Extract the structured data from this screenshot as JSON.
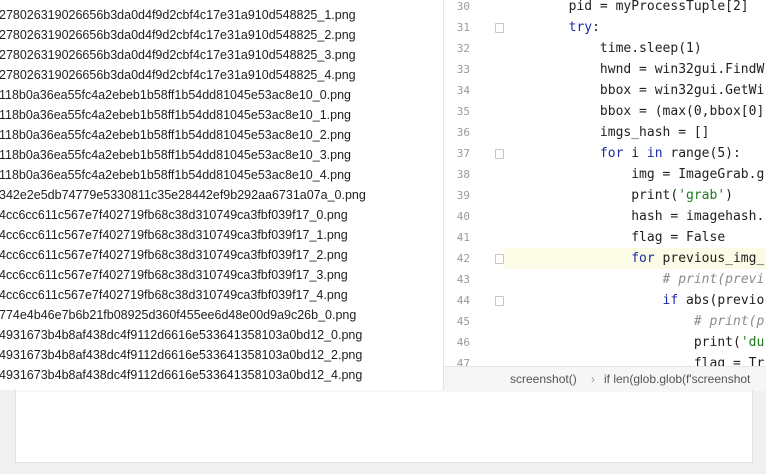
{
  "files": [
    {
      "name": "278026319026656b3da0d4f9d2cbf4c17e31a910d548825_1.png"
    },
    {
      "name": "278026319026656b3da0d4f9d2cbf4c17e31a910d548825_2.png"
    },
    {
      "name": "278026319026656b3da0d4f9d2cbf4c17e31a910d548825_3.png"
    },
    {
      "name": "278026319026656b3da0d4f9d2cbf4c17e31a910d548825_4.png"
    },
    {
      "name": "118b0a36ea55fc4a2ebeb1b58ff1b54dd81045e53ac8e10_0.png"
    },
    {
      "name": "118b0a36ea55fc4a2ebeb1b58ff1b54dd81045e53ac8e10_1.png"
    },
    {
      "name": "118b0a36ea55fc4a2ebeb1b58ff1b54dd81045e53ac8e10_2.png"
    },
    {
      "name": "118b0a36ea55fc4a2ebeb1b58ff1b54dd81045e53ac8e10_3.png"
    },
    {
      "name": "118b0a36ea55fc4a2ebeb1b58ff1b54dd81045e53ac8e10_4.png"
    },
    {
      "name": "342e2e5db74779e5330811c35e28442ef9b292aa6731a07a_0.png"
    },
    {
      "name": "4cc6cc611c567e7f402719fb68c38d310749ca3fbf039f17_0.png"
    },
    {
      "name": "4cc6cc611c567e7f402719fb68c38d310749ca3fbf039f17_1.png"
    },
    {
      "name": "4cc6cc611c567e7f402719fb68c38d310749ca3fbf039f17_2.png"
    },
    {
      "name": "4cc6cc611c567e7f402719fb68c38d310749ca3fbf039f17_3.png"
    },
    {
      "name": "4cc6cc611c567e7f402719fb68c38d310749ca3fbf039f17_4.png"
    },
    {
      "name": "774e4b46e7b6b21fb08925d360f455ee6d48e00d9a9c26b_0.png"
    },
    {
      "name": "4931673b4b8af438dc4f9112d6616e533641358103a0bd12_0.png"
    },
    {
      "name": "4931673b4b8af438dc4f9112d6616e533641358103a0bd12_2.png"
    },
    {
      "name": "4931673b4b8af438dc4f9112d6616e533641358103a0bd12_4.png"
    }
  ],
  "editor": {
    "lines": [
      {
        "num": "30",
        "indent": "        ",
        "parts": [
          {
            "t": "pid = myProcessTuple[2]",
            "c": ""
          }
        ]
      },
      {
        "num": "31",
        "indent": "        ",
        "parts": [
          {
            "t": "try",
            "c": "kw"
          },
          {
            "t": ":",
            "c": ""
          }
        ]
      },
      {
        "num": "32",
        "indent": "            ",
        "parts": [
          {
            "t": "time.sleep(1)",
            "c": ""
          }
        ]
      },
      {
        "num": "33",
        "indent": "            ",
        "parts": [
          {
            "t": "hwnd = win32gui.FindW",
            "c": ""
          }
        ]
      },
      {
        "num": "34",
        "indent": "            ",
        "parts": [
          {
            "t": "bbox = win32gui.GetWi",
            "c": ""
          }
        ]
      },
      {
        "num": "35",
        "indent": "            ",
        "parts": [
          {
            "t": "bbox = (max(0,bbox[0]",
            "c": ""
          }
        ]
      },
      {
        "num": "36",
        "indent": "            ",
        "parts": [
          {
            "t": "imgs_hash = []",
            "c": ""
          }
        ]
      },
      {
        "num": "37",
        "indent": "            ",
        "parts": [
          {
            "t": "for",
            "c": "kw"
          },
          {
            "t": " i ",
            "c": ""
          },
          {
            "t": "in",
            "c": "kw"
          },
          {
            "t": " range(5):",
            "c": ""
          }
        ]
      },
      {
        "num": "38",
        "indent": "                ",
        "parts": [
          {
            "t": "img = ImageGrab.g",
            "c": ""
          }
        ]
      },
      {
        "num": "39",
        "indent": "                ",
        "parts": [
          {
            "t": "print(",
            "c": ""
          },
          {
            "t": "'grab'",
            "c": "str"
          },
          {
            "t": ")",
            "c": ""
          }
        ]
      },
      {
        "num": "40",
        "indent": "                ",
        "parts": [
          {
            "t": "hash = imagehash.",
            "c": ""
          }
        ]
      },
      {
        "num": "41",
        "indent": "                ",
        "parts": [
          {
            "t": "flag = False",
            "c": ""
          }
        ]
      },
      {
        "num": "42",
        "indent": "                ",
        "parts": [
          {
            "t": "for",
            "c": "kw"
          },
          {
            "t": " previous_img_",
            "c": ""
          }
        ]
      },
      {
        "num": "43",
        "indent": "                    ",
        "parts": [
          {
            "t": "# print(previ",
            "c": "cmt"
          }
        ]
      },
      {
        "num": "44",
        "indent": "                    ",
        "parts": [
          {
            "t": "if",
            "c": "kw"
          },
          {
            "t": " abs(previo",
            "c": ""
          }
        ]
      },
      {
        "num": "45",
        "indent": "                        ",
        "parts": [
          {
            "t": "# print(p",
            "c": "cmt"
          }
        ]
      },
      {
        "num": "46",
        "indent": "                        ",
        "parts": [
          {
            "t": "print(",
            "c": ""
          },
          {
            "t": "'du",
            "c": "str"
          }
        ]
      },
      {
        "num": "47",
        "indent": "                        ",
        "parts": [
          {
            "t": "flag = Tr",
            "c": ""
          }
        ]
      }
    ]
  },
  "breadcrumb": {
    "item1": "screenshot()",
    "separator": "›",
    "item2": "if len(glob.glob(f'screenshot"
  }
}
